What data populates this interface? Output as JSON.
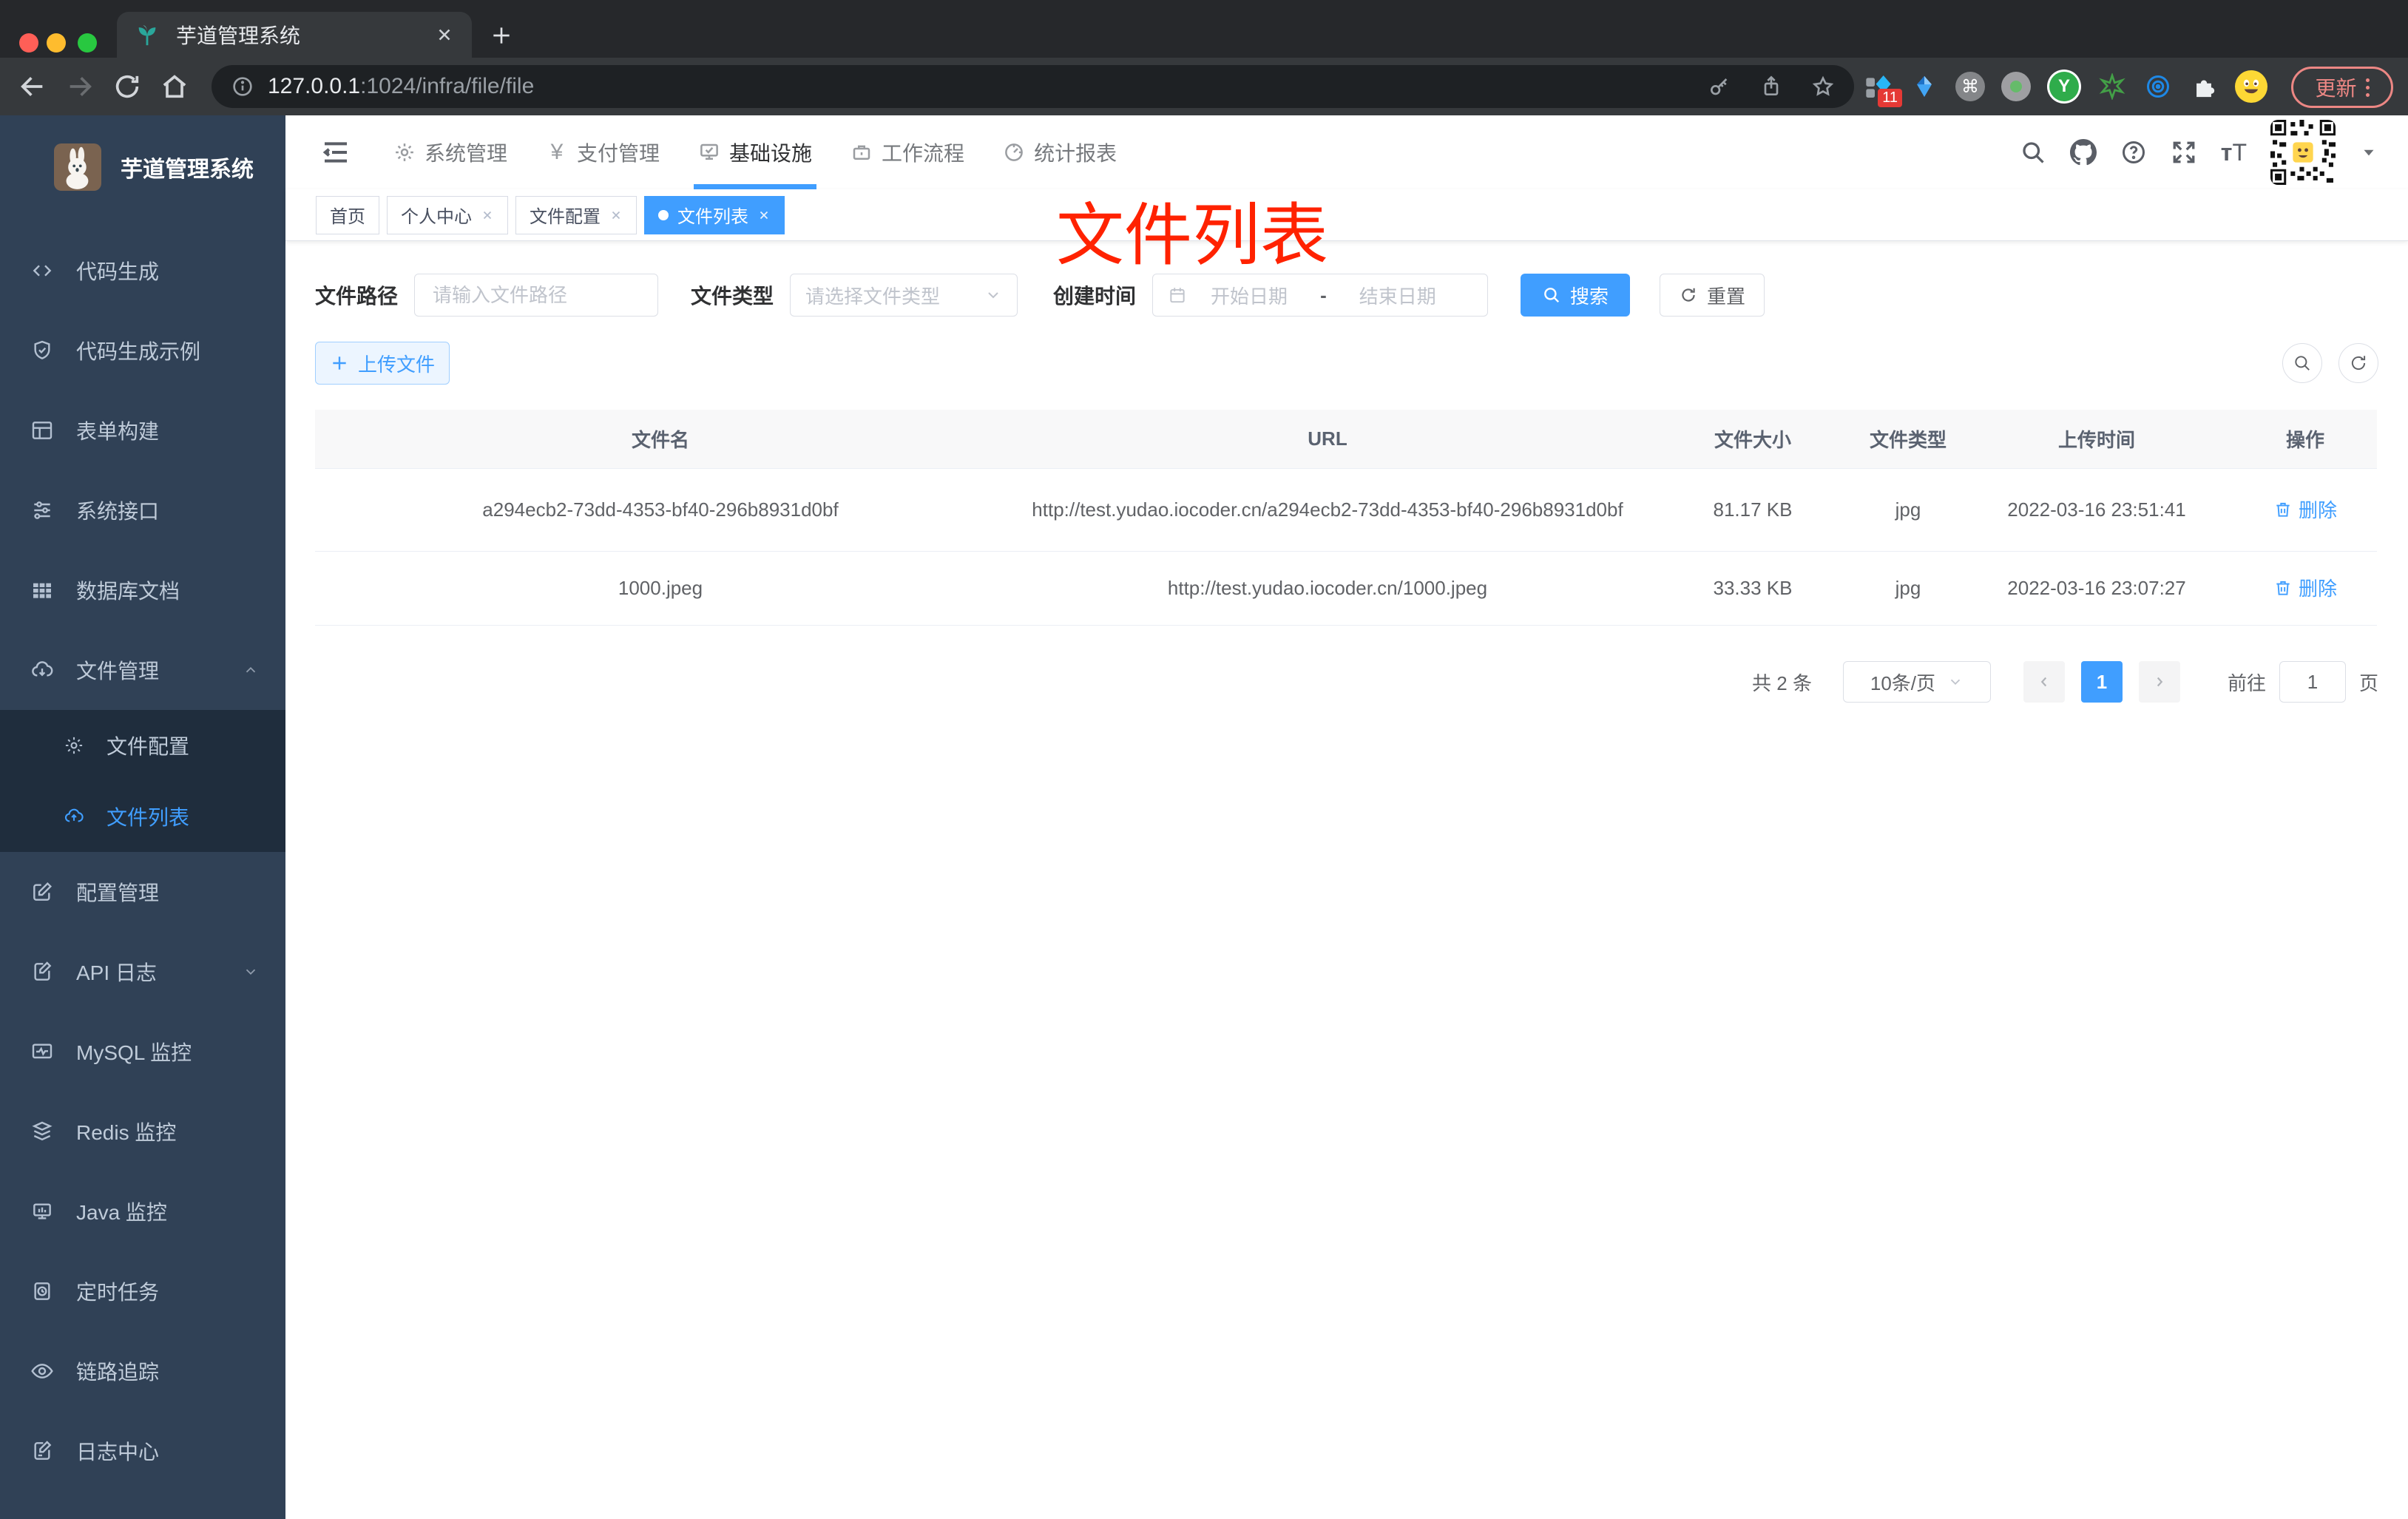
{
  "browser": {
    "tab_title": "芋道管理系统",
    "url_host": "127.0.0.1",
    "url_rest": ":1024/infra/file/file",
    "ext_badge": "11",
    "ext_y": "Y",
    "update_label": "更新"
  },
  "sidebar": {
    "title": "芋道管理系统",
    "items": [
      {
        "label": "代码生成"
      },
      {
        "label": "代码生成示例"
      },
      {
        "label": "表单构建"
      },
      {
        "label": "系统接口"
      },
      {
        "label": "数据库文档"
      },
      {
        "label": "文件管理"
      },
      {
        "label": "文件配置"
      },
      {
        "label": "文件列表"
      },
      {
        "label": "配置管理"
      },
      {
        "label": "API 日志"
      },
      {
        "label": "MySQL 监控"
      },
      {
        "label": "Redis 监控"
      },
      {
        "label": "Java 监控"
      },
      {
        "label": "定时任务"
      },
      {
        "label": "链路追踪"
      },
      {
        "label": "日志中心"
      }
    ]
  },
  "navbar": {
    "menus": [
      {
        "label": "系统管理"
      },
      {
        "label": "支付管理"
      },
      {
        "label": "基础设施"
      },
      {
        "label": "工作流程"
      },
      {
        "label": "统计报表"
      }
    ]
  },
  "tags": [
    {
      "label": "首页"
    },
    {
      "label": "个人中心"
    },
    {
      "label": "文件配置"
    },
    {
      "label": "文件列表"
    }
  ],
  "annotation": {
    "text": "文件列表",
    "color": "#ff2200"
  },
  "filters": {
    "path_label": "文件路径",
    "path_placeholder": "请输入文件路径",
    "type_label": "文件类型",
    "type_placeholder": "请选择文件类型",
    "date_label": "创建时间",
    "date_start": "开始日期",
    "date_sep": "-",
    "date_end": "结束日期",
    "search_label": "搜索",
    "reset_label": "重置"
  },
  "toolbar": {
    "upload_label": "上传文件"
  },
  "table": {
    "columns": [
      "文件名",
      "URL",
      "文件大小",
      "文件类型",
      "上传时间",
      "操作"
    ],
    "rows": [
      {
        "name": "a294ecb2-73dd-4353-bf40-296b8931d0bf",
        "url": "http://test.yudao.iocoder.cn/a294ecb2-73dd-4353-bf40-296b8931d0bf",
        "size": "81.17 KB",
        "type": "jpg",
        "time": "2022-03-16 23:51:41",
        "action": "删除"
      },
      {
        "name": "1000.jpeg",
        "url": "http://test.yudao.iocoder.cn/1000.jpeg",
        "size": "33.33 KB",
        "type": "jpg",
        "time": "2022-03-16 23:07:27",
        "action": "删除"
      }
    ]
  },
  "pagination": {
    "total": "共 2 条",
    "page_size": "10条/页",
    "current": "1",
    "goto_label": "前往",
    "goto_value": "1",
    "unit": "页"
  },
  "colors": {
    "primary": "#409eff",
    "annotation_red": "#ff2200",
    "sidebar_bg": "#304156"
  }
}
